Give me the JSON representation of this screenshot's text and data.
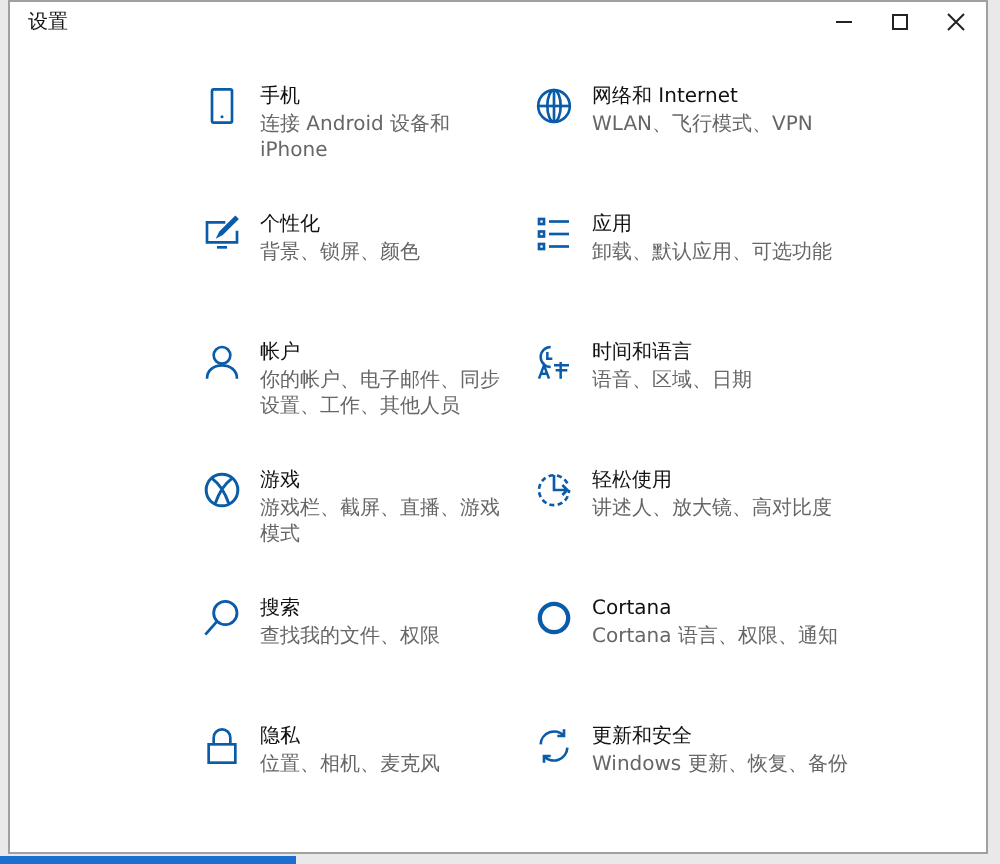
{
  "window": {
    "title": "设置"
  },
  "items": [
    {
      "kind": "phone",
      "title": "手机",
      "subtitle": "连接 Android 设备和 iPhone"
    },
    {
      "kind": "globe",
      "title": "网络和 Internet",
      "subtitle": "WLAN、飞行模式、VPN"
    },
    {
      "kind": "personalize",
      "title": "个性化",
      "subtitle": "背景、锁屏、颜色"
    },
    {
      "kind": "apps",
      "title": "应用",
      "subtitle": "卸载、默认应用、可选功能"
    },
    {
      "kind": "person",
      "title": "帐户",
      "subtitle": "你的帐户、电子邮件、同步设置、工作、其他人员"
    },
    {
      "kind": "time",
      "title": "时间和语言",
      "subtitle": "语音、区域、日期"
    },
    {
      "kind": "xbox",
      "title": "游戏",
      "subtitle": "游戏栏、截屏、直播、游戏模式"
    },
    {
      "kind": "ease",
      "title": "轻松使用",
      "subtitle": "讲述人、放大镜、高对比度"
    },
    {
      "kind": "search",
      "title": "搜索",
      "subtitle": "查找我的文件、权限"
    },
    {
      "kind": "ring",
      "title": "Cortana",
      "subtitle": "Cortana 语言、权限、通知"
    },
    {
      "kind": "lock",
      "title": "隐私",
      "subtitle": "位置、相机、麦克风"
    },
    {
      "kind": "update",
      "title": "更新和安全",
      "subtitle": "Windows 更新、恢复、备份"
    }
  ]
}
